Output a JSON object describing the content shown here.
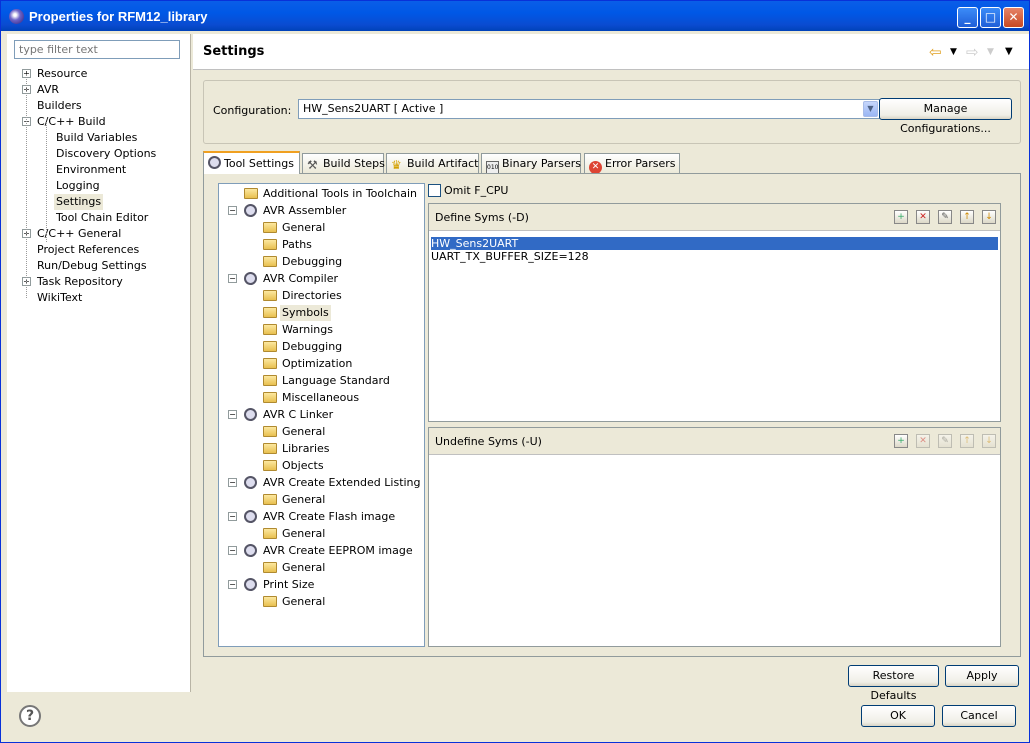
{
  "window": {
    "title": "Properties for RFM12_library"
  },
  "filter": {
    "placeholder": "type filter text"
  },
  "nav_tree": [
    {
      "label": "Resource",
      "expander": "+"
    },
    {
      "label": "AVR",
      "expander": "+"
    },
    {
      "label": "Builders"
    },
    {
      "label": "C/C++ Build",
      "expander": "−"
    },
    {
      "label": "Build Variables"
    },
    {
      "label": "Discovery Options"
    },
    {
      "label": "Environment"
    },
    {
      "label": "Logging"
    },
    {
      "label": "Settings",
      "selected": true
    },
    {
      "label": "Tool Chain Editor"
    },
    {
      "label": "C/C++ General",
      "expander": "+"
    },
    {
      "label": "Project References"
    },
    {
      "label": "Run/Debug Settings"
    },
    {
      "label": "Task Repository",
      "expander": "+"
    },
    {
      "label": "WikiText"
    }
  ],
  "header": {
    "title": "Settings"
  },
  "config": {
    "label": "Configuration:",
    "value": "HW_Sens2UART  [ Active ]",
    "manage_label": "Manage Configurations..."
  },
  "tabs": [
    {
      "label": "Tool Settings",
      "active": true
    },
    {
      "label": "Build Steps"
    },
    {
      "label": "Build Artifact"
    },
    {
      "label": "Binary Parsers"
    },
    {
      "label": "Error Parsers"
    }
  ],
  "tool_tree": [
    {
      "label": "Additional Tools in Toolchain",
      "type": "folder"
    },
    {
      "label": "AVR Assembler",
      "type": "gear"
    },
    {
      "label": "General",
      "type": "folder"
    },
    {
      "label": "Paths",
      "type": "folder"
    },
    {
      "label": "Debugging",
      "type": "folder"
    },
    {
      "label": "AVR Compiler",
      "type": "gear"
    },
    {
      "label": "Directories",
      "type": "folder"
    },
    {
      "label": "Symbols",
      "type": "folder",
      "selected": true
    },
    {
      "label": "Warnings",
      "type": "folder"
    },
    {
      "label": "Debugging",
      "type": "folder"
    },
    {
      "label": "Optimization",
      "type": "folder"
    },
    {
      "label": "Language Standard",
      "type": "folder"
    },
    {
      "label": "Miscellaneous",
      "type": "folder"
    },
    {
      "label": "AVR C Linker",
      "type": "gear"
    },
    {
      "label": "General",
      "type": "folder"
    },
    {
      "label": "Libraries",
      "type": "folder"
    },
    {
      "label": "Objects",
      "type": "folder"
    },
    {
      "label": "AVR Create Extended Listing",
      "type": "gear"
    },
    {
      "label": "General",
      "type": "folder"
    },
    {
      "label": "AVR Create Flash image",
      "type": "gear"
    },
    {
      "label": "General",
      "type": "folder"
    },
    {
      "label": "AVR Create EEPROM image",
      "type": "gear"
    },
    {
      "label": "General",
      "type": "folder"
    },
    {
      "label": "Print Size",
      "type": "gear"
    },
    {
      "label": "General",
      "type": "folder"
    }
  ],
  "omit_fcpu": {
    "label": "Omit F_CPU",
    "checked": false
  },
  "define_syms": {
    "title": "Define Syms (-D)",
    "items": [
      "HW_Sens2UART",
      "UART_TX_BUFFER_SIZE=128"
    ],
    "selected_index": 0
  },
  "undefine_syms": {
    "title": "Undefine Syms (-U)",
    "items": []
  },
  "buttons": {
    "restore": "Restore Defaults",
    "apply": "Apply",
    "ok": "OK",
    "cancel": "Cancel"
  }
}
